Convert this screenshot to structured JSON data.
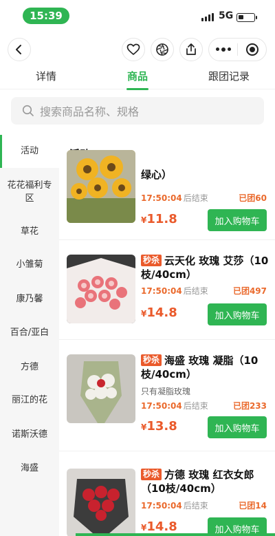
{
  "status_bar": {
    "time": "15:39",
    "network": "5G",
    "battery_level": 0.35
  },
  "nav": {
    "back_icon": "chevron-left-icon",
    "favorite_icon": "heart-icon",
    "camera_icon": "aperture-icon",
    "share_icon": "share-icon",
    "more_icon": "more-dots-icon",
    "close_icon": "target-icon"
  },
  "tabs": [
    {
      "label": "详情"
    },
    {
      "label": "商品"
    },
    {
      "label": "跟团记录"
    }
  ],
  "search": {
    "placeholder": "搜索商品名称、规格"
  },
  "sidebar": {
    "items": [
      {
        "label": "活动"
      },
      {
        "label": "花花福利专区"
      },
      {
        "label": "草花"
      },
      {
        "label": "小雏菊"
      },
      {
        "label": "康乃馨"
      },
      {
        "label": "百合/亚白"
      },
      {
        "label": "方德"
      },
      {
        "label": "丽江的花"
      },
      {
        "label": "诺斯沃德"
      },
      {
        "label": "海盛"
      }
    ]
  },
  "main": {
    "section_title": "活动",
    "products": [
      {
        "name_tail": "绿心）",
        "badge": "",
        "note": "",
        "end_time": "17:50:04",
        "end_label": "后结束",
        "joined": "已团60",
        "currency": "¥",
        "price": "11.8",
        "button": "加入购物车"
      },
      {
        "name": "云天化 玫瑰 艾莎（10枝/40cm）",
        "badge": "秒杀",
        "note": "",
        "end_time": "17:50:04",
        "end_label": "后结束",
        "joined": "已团497",
        "currency": "¥",
        "price": "14.8",
        "button": "加入购物车"
      },
      {
        "name": "海盛 玫瑰 凝脂（10枝/40cm）",
        "badge": "秒杀",
        "note": "只有凝脂玫瑰",
        "end_time": "17:50:04",
        "end_label": "后结束",
        "joined": "已团233",
        "currency": "¥",
        "price": "13.8",
        "button": "加入购物车"
      },
      {
        "name": "方德 玫瑰 红衣女郎（10枝/40cm）",
        "badge": "秒杀",
        "note": "",
        "end_time": "17:50:04",
        "end_label": "后结束",
        "joined": "已团14",
        "currency": "¥",
        "price": "14.8",
        "button": "加入购物车"
      }
    ]
  },
  "colors": {
    "accent": "#2fb553",
    "price": "#ea5a2b",
    "countdown": "#ea6a2d"
  }
}
